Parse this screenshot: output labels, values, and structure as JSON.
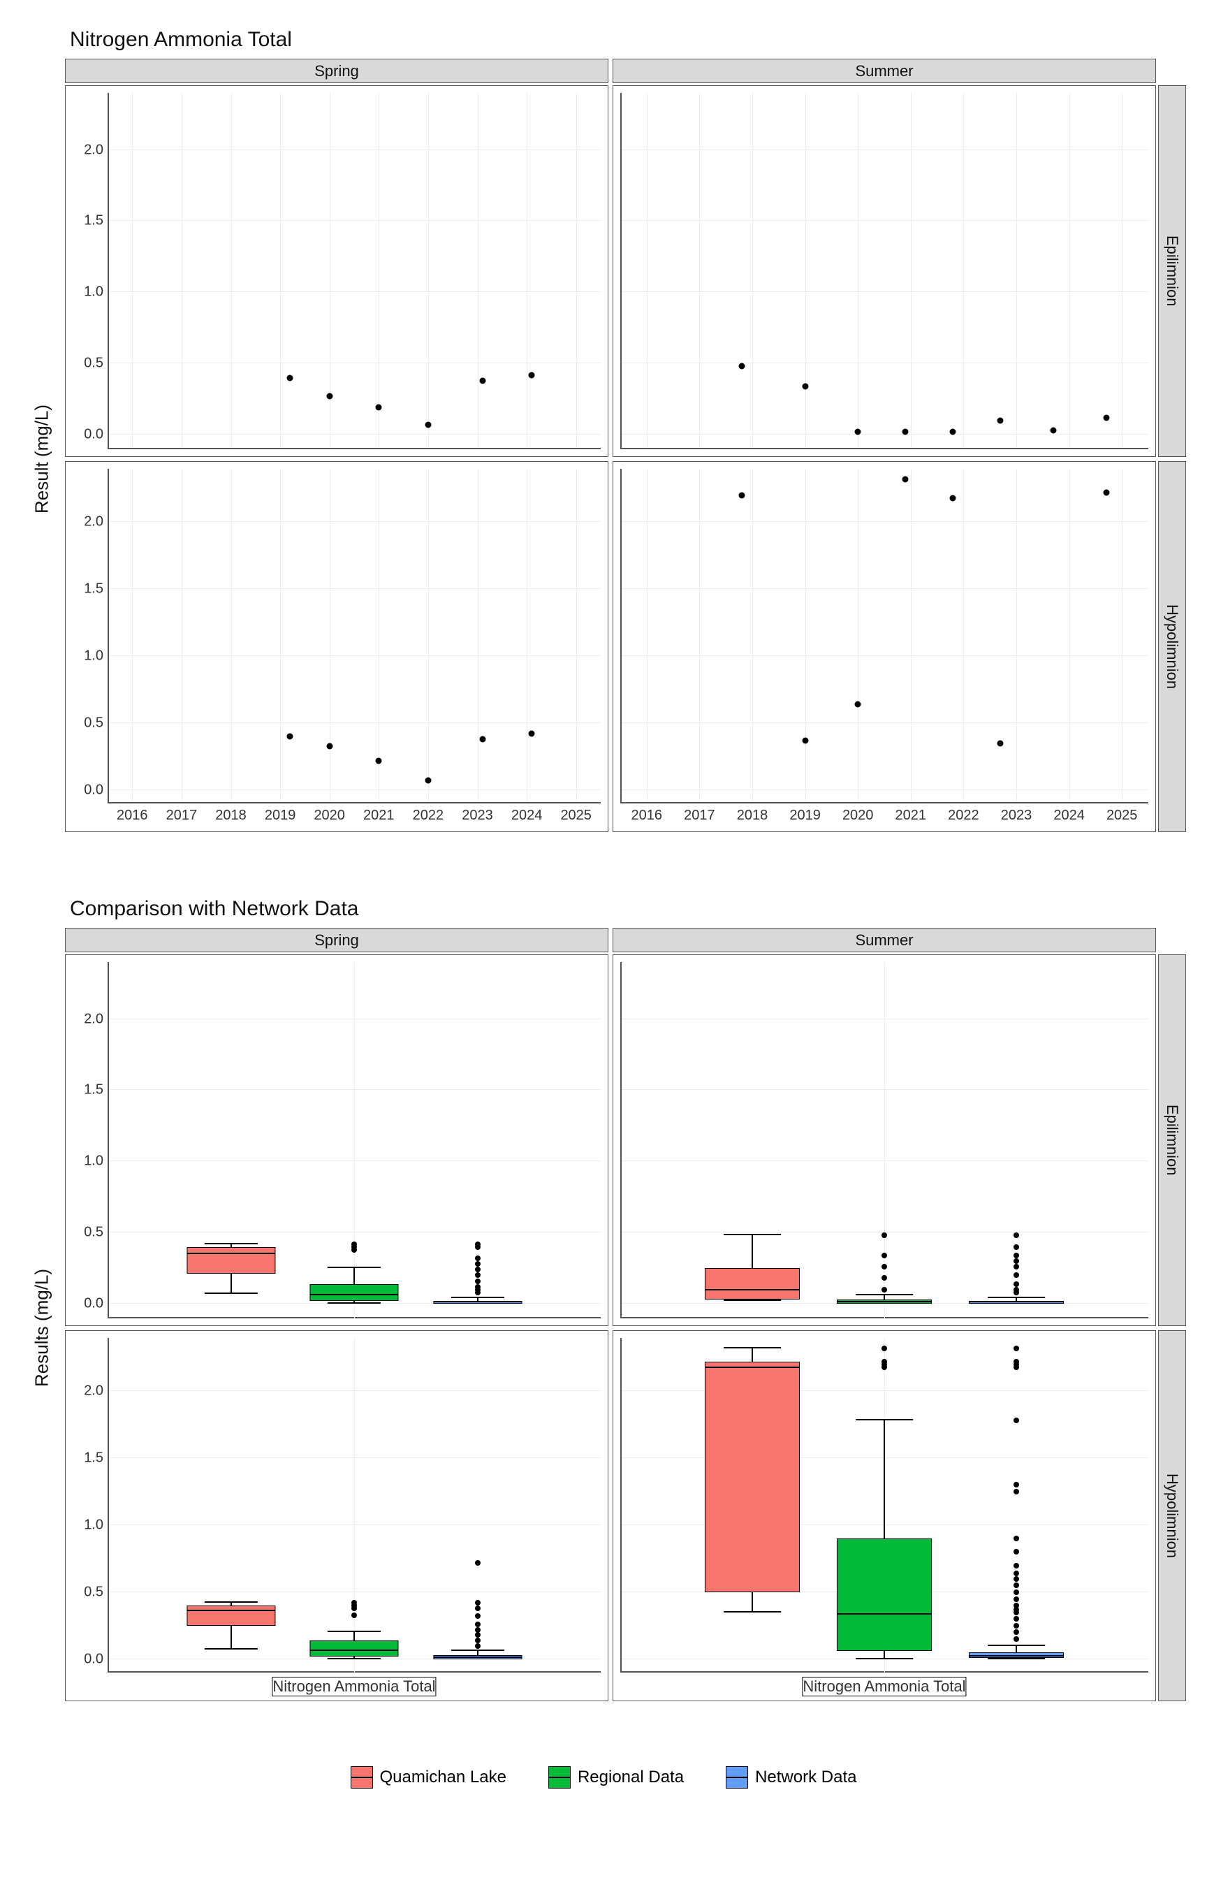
{
  "chart_data": [
    {
      "type": "scatter",
      "title": "Nitrogen Ammonia Total",
      "ylabel": "Result (mg/L)",
      "ylim": [
        -0.1,
        2.4
      ],
      "y_ticks": [
        0.0,
        0.5,
        1.0,
        1.5,
        2.0
      ],
      "xlim": [
        2015.5,
        2025.5
      ],
      "x_ticks": [
        2016,
        2017,
        2018,
        2019,
        2020,
        2021,
        2022,
        2023,
        2024,
        2025
      ],
      "col_facets": [
        "Spring",
        "Summer"
      ],
      "row_facets": [
        "Epilimnion",
        "Hypolimnion"
      ],
      "panels": {
        "Spring|Epilimnion": [
          [
            2019.2,
            0.4
          ],
          [
            2020.0,
            0.27
          ],
          [
            2021.0,
            0.19
          ],
          [
            2022.0,
            0.07
          ],
          [
            2023.1,
            0.38
          ],
          [
            2024.1,
            0.42
          ]
        ],
        "Summer|Epilimnion": [
          [
            2017.8,
            0.48
          ],
          [
            2019.0,
            0.34
          ],
          [
            2020.0,
            0.02
          ],
          [
            2020.9,
            0.02
          ],
          [
            2021.8,
            0.02
          ],
          [
            2022.7,
            0.1
          ],
          [
            2023.7,
            0.03
          ],
          [
            2024.7,
            0.12
          ]
        ],
        "Spring|Hypolimnion": [
          [
            2019.2,
            0.4
          ],
          [
            2020.0,
            0.33
          ],
          [
            2021.0,
            0.22
          ],
          [
            2022.0,
            0.07
          ],
          [
            2023.1,
            0.38
          ],
          [
            2024.1,
            0.42
          ]
        ],
        "Summer|Hypolimnion": [
          [
            2017.8,
            2.2
          ],
          [
            2019.0,
            0.37
          ],
          [
            2020.0,
            0.64
          ],
          [
            2020.9,
            2.32
          ],
          [
            2021.8,
            2.18
          ],
          [
            2022.7,
            0.35
          ],
          [
            2024.7,
            2.22
          ]
        ]
      }
    },
    {
      "type": "box",
      "title": "Comparison with Network Data",
      "ylabel": "Results (mg/L)",
      "ylim": [
        -0.1,
        2.4
      ],
      "y_ticks": [
        0.0,
        0.5,
        1.0,
        1.5,
        2.0
      ],
      "x_category": "Nitrogen Ammonia Total",
      "col_facets": [
        "Spring",
        "Summer"
      ],
      "row_facets": [
        "Epilimnion",
        "Hypolimnion"
      ],
      "series": [
        {
          "name": "Quamichan Lake",
          "color": "#f8766d"
        },
        {
          "name": "Regional Data",
          "color": "#00ba38"
        },
        {
          "name": "Network Data",
          "color": "#619cff"
        }
      ],
      "panels": {
        "Spring|Epilimnion": {
          "Quamichan Lake": {
            "min": 0.07,
            "q1": 0.21,
            "med": 0.35,
            "q3": 0.4,
            "max": 0.42,
            "out": []
          },
          "Regional Data": {
            "min": 0.0,
            "q1": 0.02,
            "med": 0.06,
            "q3": 0.14,
            "max": 0.25,
            "out": [
              0.38,
              0.4,
              0.42
            ]
          },
          "Network Data": {
            "min": 0.0,
            "q1": 0.0,
            "med": 0.01,
            "q3": 0.02,
            "max": 0.04,
            "out": [
              0.08,
              0.1,
              0.12,
              0.16,
              0.2,
              0.24,
              0.28,
              0.32,
              0.4,
              0.42
            ]
          }
        },
        "Summer|Epilimnion": {
          "Quamichan Lake": {
            "min": 0.02,
            "q1": 0.03,
            "med": 0.09,
            "q3": 0.25,
            "max": 0.48,
            "out": []
          },
          "Regional Data": {
            "min": 0.0,
            "q1": 0.0,
            "med": 0.01,
            "q3": 0.03,
            "max": 0.06,
            "out": [
              0.1,
              0.18,
              0.26,
              0.34,
              0.48
            ]
          },
          "Network Data": {
            "min": 0.0,
            "q1": 0.0,
            "med": 0.01,
            "q3": 0.02,
            "max": 0.04,
            "out": [
              0.08,
              0.1,
              0.14,
              0.2,
              0.26,
              0.3,
              0.34,
              0.4,
              0.48
            ]
          }
        },
        "Spring|Hypolimnion": {
          "Quamichan Lake": {
            "min": 0.07,
            "q1": 0.25,
            "med": 0.36,
            "q3": 0.4,
            "max": 0.42,
            "out": []
          },
          "Regional Data": {
            "min": 0.0,
            "q1": 0.02,
            "med": 0.06,
            "q3": 0.14,
            "max": 0.2,
            "out": [
              0.33,
              0.38,
              0.4,
              0.42
            ]
          },
          "Network Data": {
            "min": 0.0,
            "q1": 0.0,
            "med": 0.01,
            "q3": 0.03,
            "max": 0.06,
            "out": [
              0.1,
              0.14,
              0.18,
              0.22,
              0.26,
              0.32,
              0.38,
              0.42,
              0.72
            ]
          }
        },
        "Summer|Hypolimnion": {
          "Quamichan Lake": {
            "min": 0.35,
            "q1": 0.5,
            "med": 2.18,
            "q3": 2.22,
            "max": 2.32,
            "out": []
          },
          "Regional Data": {
            "min": 0.0,
            "q1": 0.06,
            "med": 0.33,
            "q3": 0.9,
            "max": 1.78,
            "out": [
              2.18,
              2.2,
              2.22,
              2.32
            ]
          },
          "Network Data": {
            "min": 0.0,
            "q1": 0.01,
            "med": 0.02,
            "q3": 0.05,
            "max": 0.1,
            "out": [
              0.15,
              0.2,
              0.25,
              0.3,
              0.35,
              0.37,
              0.4,
              0.45,
              0.5,
              0.55,
              0.6,
              0.64,
              0.7,
              0.8,
              0.9,
              1.25,
              1.3,
              1.78,
              2.18,
              2.2,
              2.22,
              2.32
            ]
          }
        }
      }
    }
  ],
  "legend_title": "",
  "titles": {
    "scatter": "Nitrogen Ammonia Total",
    "box": "Comparison with Network Data"
  },
  "ylabels": {
    "scatter": "Result (mg/L)",
    "box": "Results (mg/L)"
  },
  "facets": {
    "cols": [
      "Spring",
      "Summer"
    ],
    "rows": [
      "Epilimnion",
      "Hypolimnion"
    ]
  },
  "x_category_label": "Nitrogen Ammonia Total",
  "legend": [
    {
      "name": "Quamichan Lake",
      "color": "#f8766d"
    },
    {
      "name": "Regional Data",
      "color": "#00ba38"
    },
    {
      "name": "Network Data",
      "color": "#619cff"
    }
  ]
}
